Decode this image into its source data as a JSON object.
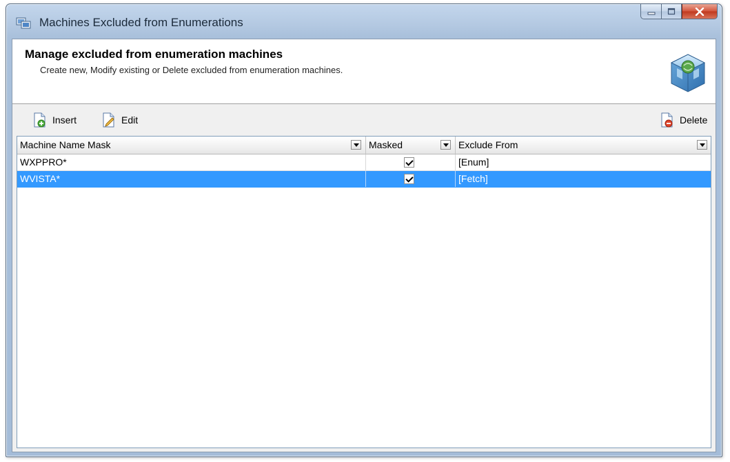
{
  "window": {
    "title": "Machines Excluded from Enumerations"
  },
  "header": {
    "title": "Manage excluded from enumeration machines",
    "description": "Create new, Modify existing or Delete excluded from enumeration machines."
  },
  "toolbar": {
    "insert_label": "Insert",
    "edit_label": "Edit",
    "delete_label": "Delete"
  },
  "grid": {
    "columns": [
      {
        "label": "Machine Name Mask"
      },
      {
        "label": "Masked"
      },
      {
        "label": "Exclude From"
      }
    ],
    "rows": [
      {
        "machine_name_mask": "WXPPRO*",
        "masked": true,
        "exclude_from": "[Enum]",
        "selected": false
      },
      {
        "machine_name_mask": "WVISTA*",
        "masked": true,
        "exclude_from": "[Fetch]",
        "selected": true
      }
    ]
  },
  "colors": {
    "selection": "#3399ff",
    "close_button": "#c7432a",
    "titlebar": "#b9cde5"
  }
}
